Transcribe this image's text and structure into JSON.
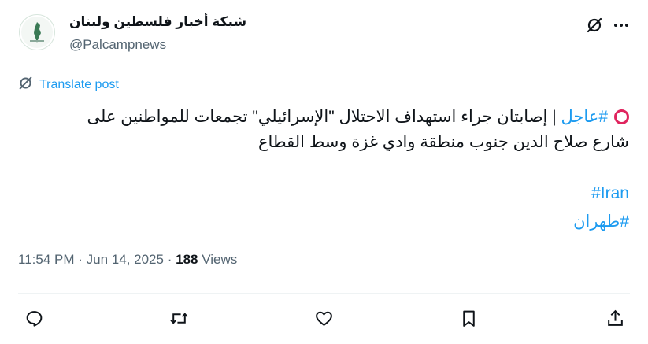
{
  "author": {
    "display_name": "شبكة أخبار فلسطين ولبنان",
    "handle": "@Palcampnews",
    "avatar_icon": "map-logo-icon"
  },
  "header": {
    "grok_icon": "grok-slash-icon",
    "more_icon": "more-dots-icon"
  },
  "translate": {
    "label": "Translate post",
    "icon": "grok-slash-icon"
  },
  "post": {
    "breaking_hashtag": "#عاجل",
    "line1_text": " | إصابتان جراء استهداف الاحتلال \"الإسرائيلي\" تجمعات للمواطنين على",
    "line2_text": "شارع صلاح الدين جنوب منطقة وادي غزة وسط القطاع",
    "hashtags": [
      "#Iran",
      "#طهران"
    ]
  },
  "meta": {
    "time": "11:54 PM",
    "separator": "·",
    "date": "Jun 14, 2025",
    "views_count": "188",
    "views_label": "Views"
  },
  "actions": [
    {
      "name": "reply",
      "icon": "reply-icon"
    },
    {
      "name": "repost",
      "icon": "repost-icon"
    },
    {
      "name": "like",
      "icon": "like-icon"
    },
    {
      "name": "bookmark",
      "icon": "bookmark-icon"
    },
    {
      "name": "share",
      "icon": "share-icon"
    }
  ],
  "colors": {
    "accent": "#1d9bf0",
    "text": "#0f1419",
    "muted": "#536471",
    "breaking_circle": "#e0245e"
  }
}
